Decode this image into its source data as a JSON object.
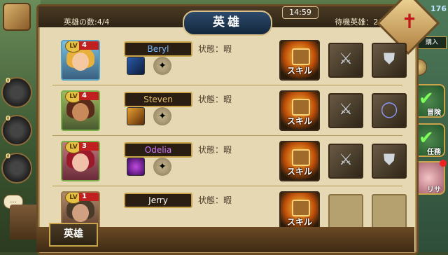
{
  "header": {
    "hero_count": "英雄の数:4/4",
    "title": "英雄",
    "clock": "14:59",
    "waiting": "待機英雄：2/3"
  },
  "right_panel": {
    "top_count": "176",
    "buy_label": "購入",
    "zero": "0",
    "adventure_label": "冒険",
    "quest_label": "任務",
    "lisa_label": "リサ"
  },
  "left_panel": {
    "slots": [
      "0",
      "0",
      "0"
    ],
    "chat": "..."
  },
  "heroes": [
    {
      "name": "Beryl",
      "name_color": "#7ab8ff",
      "lv_label": "LV",
      "level": "4",
      "status": "状態：暇",
      "skill_label": "スキル",
      "equip": [
        "sword",
        "armor"
      ]
    },
    {
      "name": "Steven",
      "name_color": "#e3c06a",
      "lv_label": "LV",
      "level": "4",
      "status": "状態：暇",
      "skill_label": "スキル",
      "equip": [
        "sword",
        "ring"
      ]
    },
    {
      "name": "Odelia",
      "name_color": "#d07aff",
      "lv_label": "LV",
      "level": "3",
      "status": "状態：暇",
      "skill_label": "スキル",
      "equip": [
        "sword",
        "armor"
      ]
    },
    {
      "name": "Jerry",
      "name_color": "#ffffff",
      "lv_label": "LV",
      "level": "1",
      "status": "状態：暇",
      "skill_label": "スキル",
      "equip": [
        "empty",
        "empty"
      ]
    }
  ],
  "footer": {
    "tab": "英雄"
  }
}
